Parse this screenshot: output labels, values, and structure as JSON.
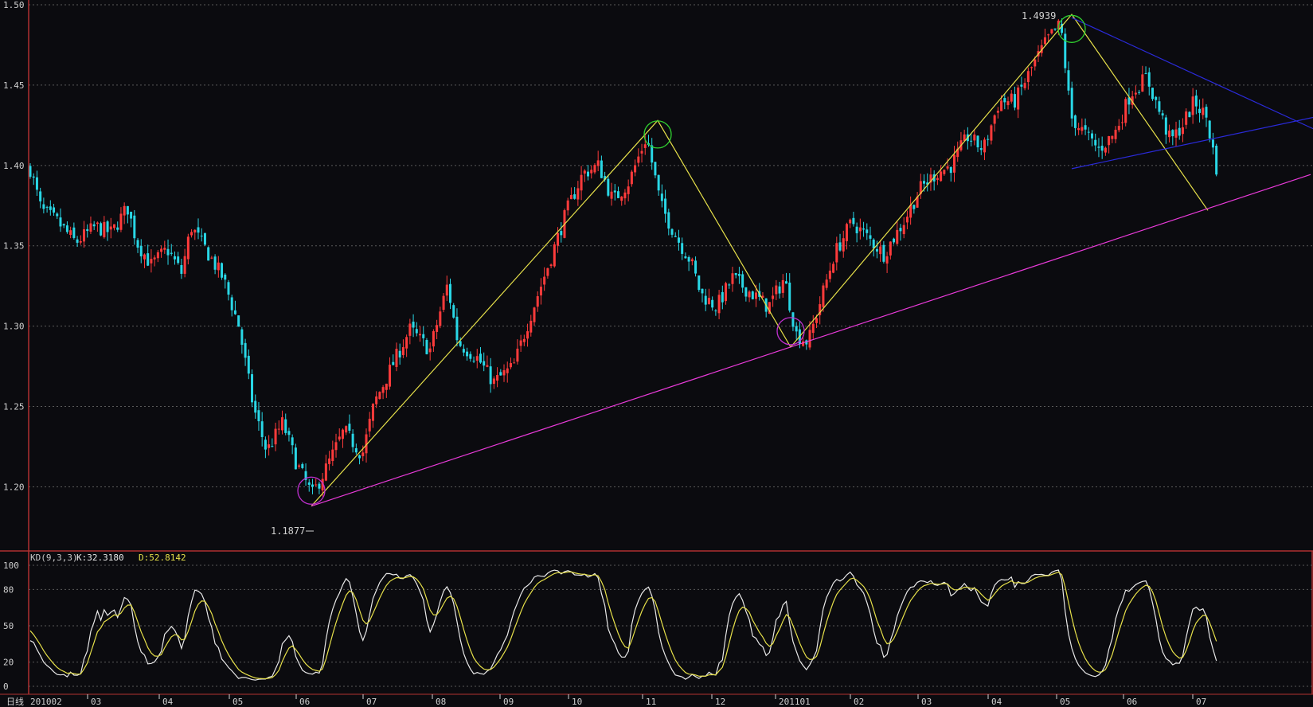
{
  "colors": {
    "background": "#0b0b0f",
    "grid": "#5a5a5a",
    "frame": "#b03030",
    "up_candle": "#ff3b3b",
    "down_candle": "#29d7e6",
    "k_line": "#e8e8e8",
    "d_line": "#e6e04a",
    "trend_yellow": "#e6e04a",
    "support_magenta": "#e83ad8",
    "triangle_blue": "#2a2ad8",
    "circle_green": "#30d030",
    "circle_magenta": "#c030d0",
    "label": "#d0d0d0"
  },
  "price_axis": {
    "ticks": [
      "1.50",
      "1.45",
      "1.40",
      "1.35",
      "1.30",
      "1.25",
      "1.20"
    ],
    "min": 1.17,
    "max": 1.5
  },
  "kd_axis": {
    "ticks": [
      "100",
      "80",
      "50",
      "20",
      "0"
    ],
    "min": 0,
    "max": 100
  },
  "kd_header": {
    "name": "KD(9,3,3)",
    "k_label": "K:32.3180",
    "d_label": "D:52.8142"
  },
  "period_label": "日线",
  "time_axis": [
    "201002",
    "03",
    "04",
    "05",
    "06",
    "07",
    "08",
    "09",
    "10",
    "11",
    "12",
    "201101",
    "02",
    "03",
    "04",
    "05",
    "06",
    "07"
  ],
  "annotations": {
    "high_label": "1.4939",
    "low_label": "1.1877"
  },
  "chart_data": {
    "type": "candlestick",
    "title": "",
    "ylim": [
      1.17,
      1.5
    ],
    "timeframe": "daily",
    "x_range": [
      "2010-02",
      "2011-07"
    ],
    "key_points": [
      {
        "date": "2010-06",
        "price": 1.1877,
        "label": "1.1877",
        "kind": "low"
      },
      {
        "date": "2010-11",
        "price": 1.4282,
        "kind": "high"
      },
      {
        "date": "2011-01",
        "price": 1.287,
        "kind": "low"
      },
      {
        "date": "2011-05",
        "price": 1.4939,
        "label": "1.4939",
        "kind": "high"
      }
    ],
    "trend_lines": [
      {
        "name": "zigzag",
        "color": "yellow",
        "points": [
          [
            "2010-06",
            1.188
          ],
          [
            "2010-11",
            1.428
          ],
          [
            "2011-01",
            1.287
          ],
          [
            "2011-05",
            1.494
          ],
          [
            "2011-07",
            1.372
          ]
        ]
      },
      {
        "name": "support",
        "color": "magenta",
        "points": [
          [
            "2010-06",
            1.188
          ],
          [
            "2011-01",
            1.287
          ]
        ]
      },
      {
        "name": "triangle-upper",
        "color": "blue",
        "points": [
          [
            "2011-05",
            1.492
          ],
          [
            "2011-07",
            1.453
          ]
        ]
      },
      {
        "name": "triangle-lower",
        "color": "blue",
        "points": [
          [
            "2011-05",
            1.398
          ],
          [
            "2011-07",
            1.416
          ]
        ]
      }
    ],
    "indicator": {
      "name": "KD(9,3,3)",
      "K": 32.318,
      "D": 52.8142,
      "ylim": [
        0,
        100
      ]
    }
  }
}
